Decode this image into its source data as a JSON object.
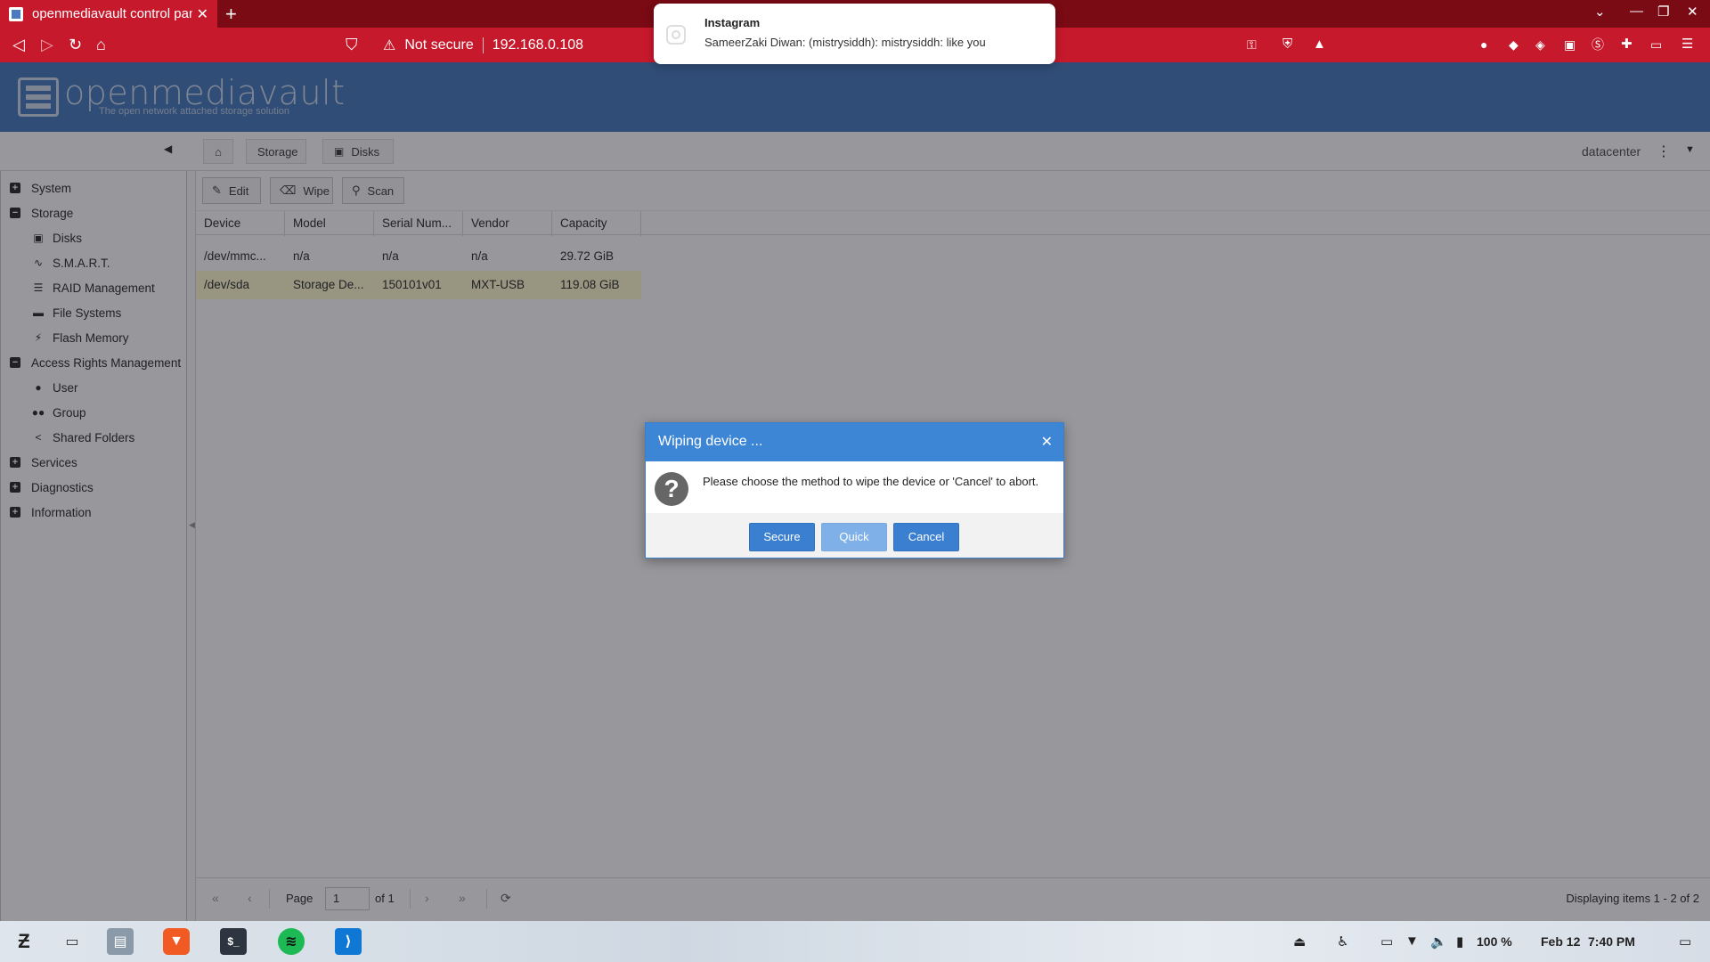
{
  "browser": {
    "tab_title": "openmediavault control pane",
    "not_secure": "Not secure",
    "url": "192.168.0.108"
  },
  "notification": {
    "app": "Instagram",
    "message": "SameerZaki Diwan: (mistrysiddh): mistrysiddh: like you"
  },
  "header": {
    "logo": "openmediavault",
    "tagline": "The open network attached storage solution"
  },
  "breadcrumb": {
    "storage": "Storage",
    "disks": "Disks",
    "hostname": "datacenter"
  },
  "sidebar": {
    "items": [
      {
        "label": "System"
      },
      {
        "label": "Storage"
      },
      {
        "label": "Disks"
      },
      {
        "label": "S.M.A.R.T."
      },
      {
        "label": "RAID Management"
      },
      {
        "label": "File Systems"
      },
      {
        "label": "Flash Memory"
      },
      {
        "label": "Access Rights Management"
      },
      {
        "label": "User"
      },
      {
        "label": "Group"
      },
      {
        "label": "Shared Folders"
      },
      {
        "label": "Services"
      },
      {
        "label": "Diagnostics"
      },
      {
        "label": "Information"
      }
    ]
  },
  "actions": {
    "edit": "Edit",
    "wipe": "Wipe",
    "scan": "Scan"
  },
  "grid": {
    "columns": [
      "Device",
      "Model",
      "Serial Num...",
      "Vendor",
      "Capacity"
    ],
    "rows": [
      [
        "/dev/mmc...",
        "n/a",
        "n/a",
        "n/a",
        "29.72 GiB"
      ],
      [
        "/dev/sda",
        "Storage De...",
        "150101v01",
        "MXT-USB",
        "119.08 GiB"
      ]
    ]
  },
  "pager": {
    "page_label": "Page",
    "page_value": "1",
    "of_total": "of 1",
    "displaying": "Displaying items 1 - 2 of 2"
  },
  "dialog": {
    "title": "Wiping device ...",
    "message": "Please choose the method to wipe the device or 'Cancel' to abort.",
    "secure": "Secure",
    "quick": "Quick",
    "cancel": "Cancel"
  },
  "taskbar": {
    "volume": "100 %",
    "date": "Feb 12",
    "time": "7:40 PM"
  },
  "colors": {
    "browser_accent": "#c7192c",
    "omv_header": "#4d7fc0",
    "dialog_header": "#3d86d6",
    "selected_row": "#fffbd0"
  }
}
